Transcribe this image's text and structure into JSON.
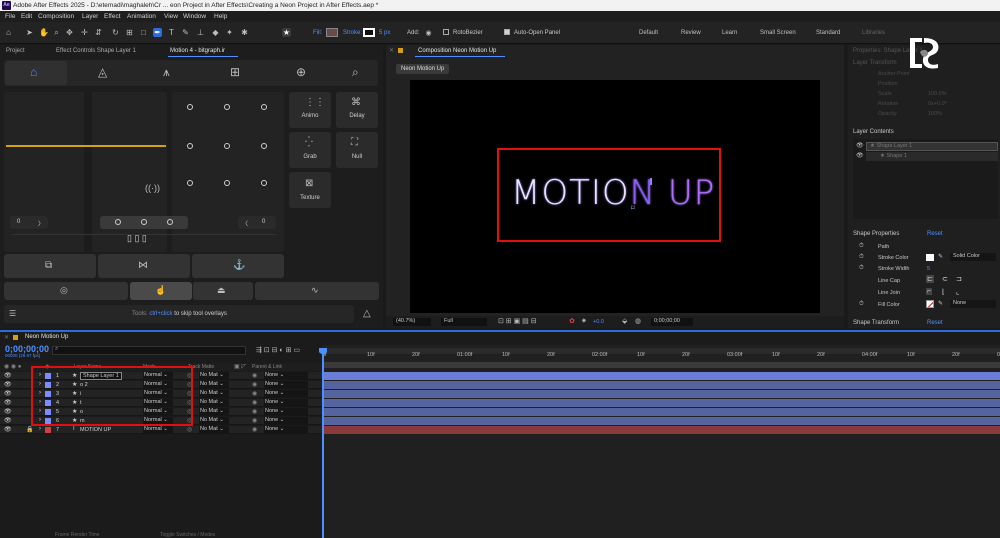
{
  "window": {
    "app_logo": "Ae",
    "title": "Adobe After Effects 2025 - D:\\etemadi\\maghaleh\\Cr ... eon Project in After Effects\\Creating a Neon Project in After Effects.aep *"
  },
  "menu": [
    "File",
    "Edit",
    "Composition",
    "Layer",
    "Effect",
    "Animation",
    "View",
    "Window",
    "Help"
  ],
  "toolbar": {
    "fill_label": "Fill:",
    "stroke_label": "Stroke:",
    "stroke_value": "5 px",
    "add_label": "Add:",
    "rotobezier": "RotoBezier",
    "auto_open": "Auto-Open Panel",
    "workspaces": [
      "Default",
      "Review",
      "Learn",
      "Small Screen",
      "Standard",
      "Libraries"
    ],
    "fill_color": "#6b4a4a",
    "stroke_color": "#ffffff"
  },
  "left_tabs": {
    "project": "Project",
    "effect_controls": "Effect Controls Shape Layer 1",
    "motion": "Motion 4 - bitgraph.ir"
  },
  "motion_panel": {
    "buttons": [
      "Animo",
      "Delay",
      "Grab",
      "Null",
      "Texture"
    ],
    "left_value": "0",
    "right_value": "0",
    "hint_prefix": "Tools:",
    "hint_key": "ctrl+click",
    "hint_suffix": "to skip tool overlays",
    "accent": "#d4a017"
  },
  "composition": {
    "tab": "Composition Neon Motion Up",
    "crumb": "Neon Motion Up",
    "text_left": "MOTIO",
    "text_n": "N",
    "text_right": " UP",
    "zoom": "(40.7%)",
    "quality": "Full",
    "exposure": "+0.0",
    "timecode": "0;00;00;00",
    "highlight_color": "#e01010"
  },
  "properties": {
    "title": "Properties: Shape Layer 1",
    "layer_transform": "Layer Transform",
    "transform_items": [
      "Anchor Point",
      "Position",
      "Scale",
      "Rotation",
      "Opacity"
    ],
    "transform_values": [
      "",
      "",
      "100.0%",
      "0x+0.0°",
      "100%"
    ],
    "layer_contents": "Layer Contents",
    "contents": [
      "Shape Layer 1",
      "Shape 1"
    ],
    "shape_properties": "Shape Properties",
    "reset": "Reset",
    "items": [
      "Path",
      "Stroke Color",
      "Stroke Width",
      "Line Cap",
      "Line Join",
      "Fill Color"
    ],
    "stroke_width_value": "5",
    "solid_color": "Solid Color",
    "fill_none": "None",
    "shape_transform": "Shape Transform"
  },
  "timeline": {
    "tab": "Neon Motion Up",
    "timecode": "0;00;00;00",
    "fps": "00000 (29.97 fps)",
    "columns": {
      "layer_name": "Layer Name",
      "mode": "Mode",
      "track_matte": "Track Matte",
      "parent": "Parent & Link"
    },
    "layers": [
      {
        "num": "1",
        "icon": "star",
        "name": "Shape Layer 1",
        "mode": "Normal",
        "matte": "No Mat",
        "parent": "None",
        "label": "#7a8cff"
      },
      {
        "num": "2",
        "icon": "star",
        "name": "o 2",
        "mode": "Normal",
        "matte": "No Mat",
        "parent": "None",
        "label": "#7a8cff"
      },
      {
        "num": "3",
        "icon": "star",
        "name": "i",
        "mode": "Normal",
        "matte": "No Mat",
        "parent": "None",
        "label": "#7a8cff"
      },
      {
        "num": "4",
        "icon": "star",
        "name": "t",
        "mode": "Normal",
        "matte": "No Mat",
        "parent": "None",
        "label": "#7a8cff"
      },
      {
        "num": "5",
        "icon": "star",
        "name": "o",
        "mode": "Normal",
        "matte": "No Mat",
        "parent": "None",
        "label": "#7a8cff"
      },
      {
        "num": "6",
        "icon": "star",
        "name": "m",
        "mode": "Normal",
        "matte": "No Mat",
        "parent": "None",
        "label": "#7a8cff"
      },
      {
        "num": "7",
        "icon": "T",
        "name": "MOTION UP",
        "mode": "Normal",
        "matte": "No Mat",
        "parent": "None",
        "label": "#d04040"
      }
    ],
    "ruler": [
      "0f",
      "10f",
      "20f",
      "01:00f",
      "10f",
      "20f",
      "02:00f",
      "10f",
      "20f",
      "03:00f",
      "10f",
      "20f",
      "04:00f",
      "10f",
      "20f",
      "05:0"
    ],
    "footer": [
      "Frame Render Time",
      "Toggle Switches / Modes"
    ]
  },
  "watermark": "logo"
}
